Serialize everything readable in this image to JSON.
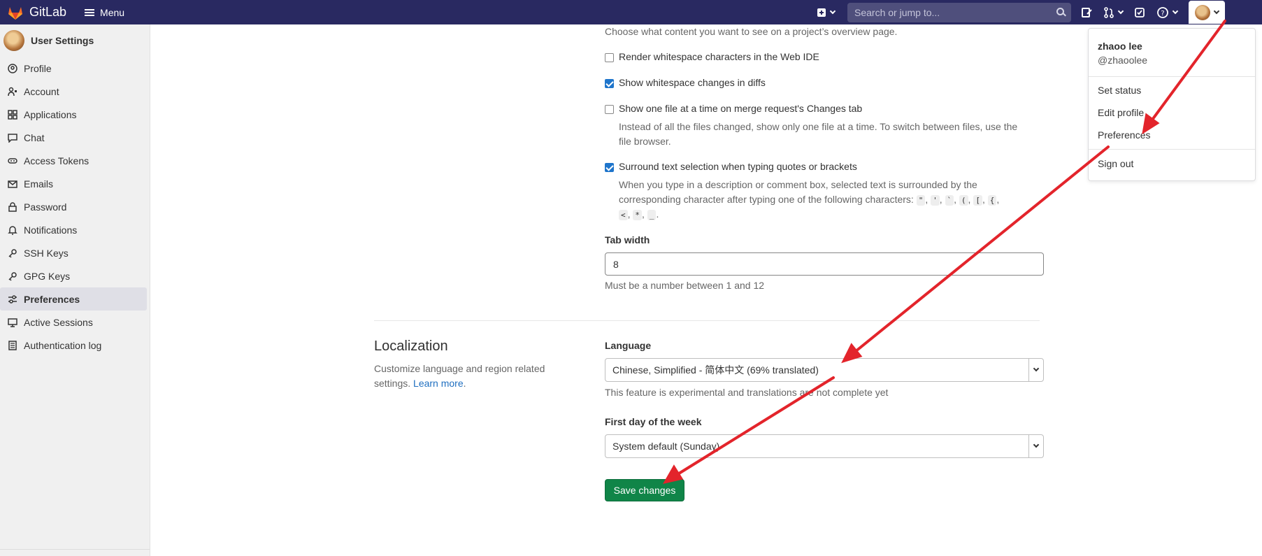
{
  "app": {
    "name": "GitLab",
    "menu_label": "Menu"
  },
  "search": {
    "placeholder": "Search or jump to..."
  },
  "sidebar": {
    "title": "User Settings",
    "items": [
      {
        "label": "Profile",
        "icon": "profile-icon"
      },
      {
        "label": "Account",
        "icon": "account-icon"
      },
      {
        "label": "Applications",
        "icon": "applications-icon"
      },
      {
        "label": "Chat",
        "icon": "chat-icon"
      },
      {
        "label": "Access Tokens",
        "icon": "token-icon"
      },
      {
        "label": "Emails",
        "icon": "mail-icon"
      },
      {
        "label": "Password",
        "icon": "lock-icon"
      },
      {
        "label": "Notifications",
        "icon": "bell-icon"
      },
      {
        "label": "SSH Keys",
        "icon": "key-icon"
      },
      {
        "label": "GPG Keys",
        "icon": "key-icon"
      },
      {
        "label": "Preferences",
        "icon": "preferences-icon"
      },
      {
        "label": "Active Sessions",
        "icon": "monitor-icon"
      },
      {
        "label": "Authentication log",
        "icon": "log-icon"
      }
    ],
    "active_index": 10
  },
  "behavior": {
    "overview_help": "Choose what content you want to see on a project’s overview page.",
    "options": [
      {
        "label": "Render whitespace characters in the Web IDE",
        "checked": false
      },
      {
        "label": "Show whitespace changes in diffs",
        "checked": true
      },
      {
        "label": "Show one file at a time on merge request's Changes tab",
        "checked": false,
        "help_line1": "Instead of all the files changed, show only one file at a time. To switch between files, use the",
        "help_line2": "file browser."
      },
      {
        "label": "Surround text selection when typing quotes or brackets",
        "checked": true,
        "help_line1": "When you type in a description or comment box, selected text is surrounded by the",
        "help_line2": "corresponding character after typing one of the following characters:",
        "chars": [
          "\"",
          "'",
          "`",
          "(",
          "[",
          "{",
          "<",
          "*",
          "_"
        ]
      }
    ],
    "tab_width": {
      "label": "Tab width",
      "value": "8",
      "help": "Must be a number between 1 and 12"
    }
  },
  "localization": {
    "title": "Localization",
    "description": "Customize language and region related settings.",
    "learn_more": "Learn more",
    "language": {
      "label": "Language",
      "value": "Chinese, Simplified - 简体中文 (69% translated)",
      "help": "This feature is experimental and translations are not complete yet"
    },
    "first_day": {
      "label": "First day of the week",
      "value": "System default (Sunday)"
    }
  },
  "save_label": "Save changes",
  "user_menu": {
    "name": "zhaoo lee",
    "handle": "@zhaoolee",
    "items": [
      "Set status",
      "Edit profile",
      "Preferences",
      "Sign out"
    ]
  },
  "colors": {
    "navbar": "#292961",
    "save": "#108548",
    "checkbox": "#1f75cb",
    "arrow": "#e3242b"
  }
}
